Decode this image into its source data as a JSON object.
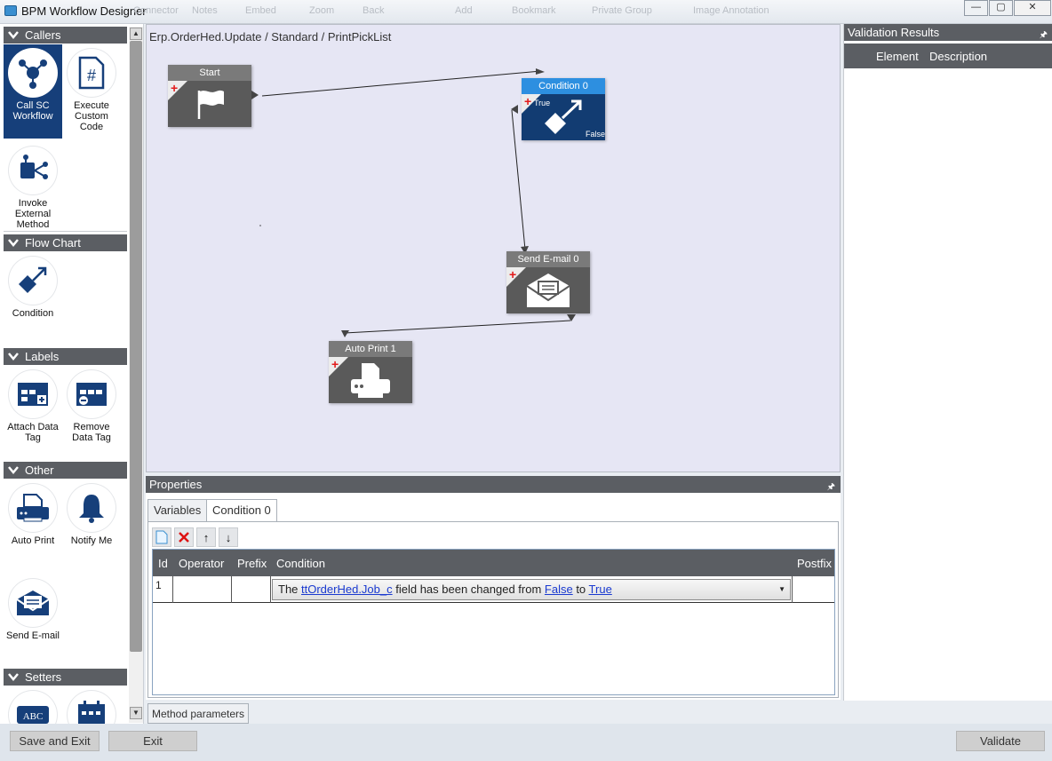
{
  "window": {
    "title": "BPM Workflow Designer",
    "ghost_toolbar": [
      "Connector",
      "Notes",
      "Embed",
      "Zoom",
      "Back",
      "Add",
      "Bookmark",
      "Private Group",
      "Image Annotation"
    ],
    "controls": {
      "minimize": "—",
      "restore": "▢",
      "close": "✕"
    }
  },
  "toolbox": {
    "groups": [
      {
        "label": "Callers",
        "items": [
          {
            "label": "Call SC Workflow",
            "icon": "call-sc-workflow-icon",
            "selected": true
          },
          {
            "label": "Execute Custom Code",
            "icon": "hash-document-icon"
          },
          {
            "label": "Invoke External Method",
            "icon": "invoke-method-icon"
          }
        ]
      },
      {
        "label": "Flow Chart",
        "items": [
          {
            "label": "Condition",
            "icon": "condition-icon"
          }
        ]
      },
      {
        "label": "Labels",
        "items": [
          {
            "label": "Attach Data Tag",
            "icon": "attach-tag-icon"
          },
          {
            "label": "Remove Data Tag",
            "icon": "remove-tag-icon"
          }
        ]
      },
      {
        "label": "Other",
        "items": [
          {
            "label": "Auto Print",
            "icon": "printer-icon"
          },
          {
            "label": "Notify Me",
            "icon": "bell-icon"
          },
          {
            "label": "Send E-mail",
            "icon": "envelope-icon"
          }
        ]
      },
      {
        "label": "Setters",
        "items": [
          {
            "label": "",
            "icon": "abc-icon"
          },
          {
            "label": "",
            "icon": "calendar-icon"
          }
        ]
      }
    ]
  },
  "canvas": {
    "breadcrumb": "Erp.OrderHed.Update / Standard / PrintPickList",
    "nodes": {
      "start": {
        "title": "Start"
      },
      "condition": {
        "title": "Condition 0",
        "true_label": "True",
        "false_label": "False"
      },
      "send_email": {
        "title": "Send E-mail 0"
      },
      "auto_print": {
        "title": "Auto Print 1"
      }
    }
  },
  "properties": {
    "title": "Properties",
    "pin": "🖈",
    "tabs": [
      {
        "label": "Variables"
      },
      {
        "label": "Condition 0",
        "active": true
      }
    ],
    "toolbar": {
      "new": "new-document-icon",
      "delete": "delete-x-icon",
      "up": "↑",
      "down": "↓"
    },
    "grid": {
      "headers": {
        "id": "Id",
        "operator": "Operator",
        "prefix": "Prefix",
        "condition": "Condition",
        "postfix": "Postfix"
      },
      "rows": [
        {
          "id": "1",
          "operator": "",
          "prefix": "",
          "postfix": "",
          "condition": {
            "t1": "The ",
            "field": "ttOrderHed.Job_c",
            "t2": " field has been changed from ",
            "from": "False",
            "t3": " to ",
            "to": "True"
          }
        }
      ]
    },
    "bottom_tab": "Method parameters"
  },
  "validation": {
    "title": "Validation Results",
    "pin": "🖈",
    "columns": {
      "element": "Element",
      "description": "Description"
    }
  },
  "footer": {
    "save_exit": "Save and Exit",
    "exit": "Exit",
    "validate": "Validate"
  },
  "colors": {
    "accent": "#2d8fe0",
    "selected_tool": "#163f7a",
    "panel_header": "#5b5e63",
    "canvas": "#e6e6f4"
  }
}
